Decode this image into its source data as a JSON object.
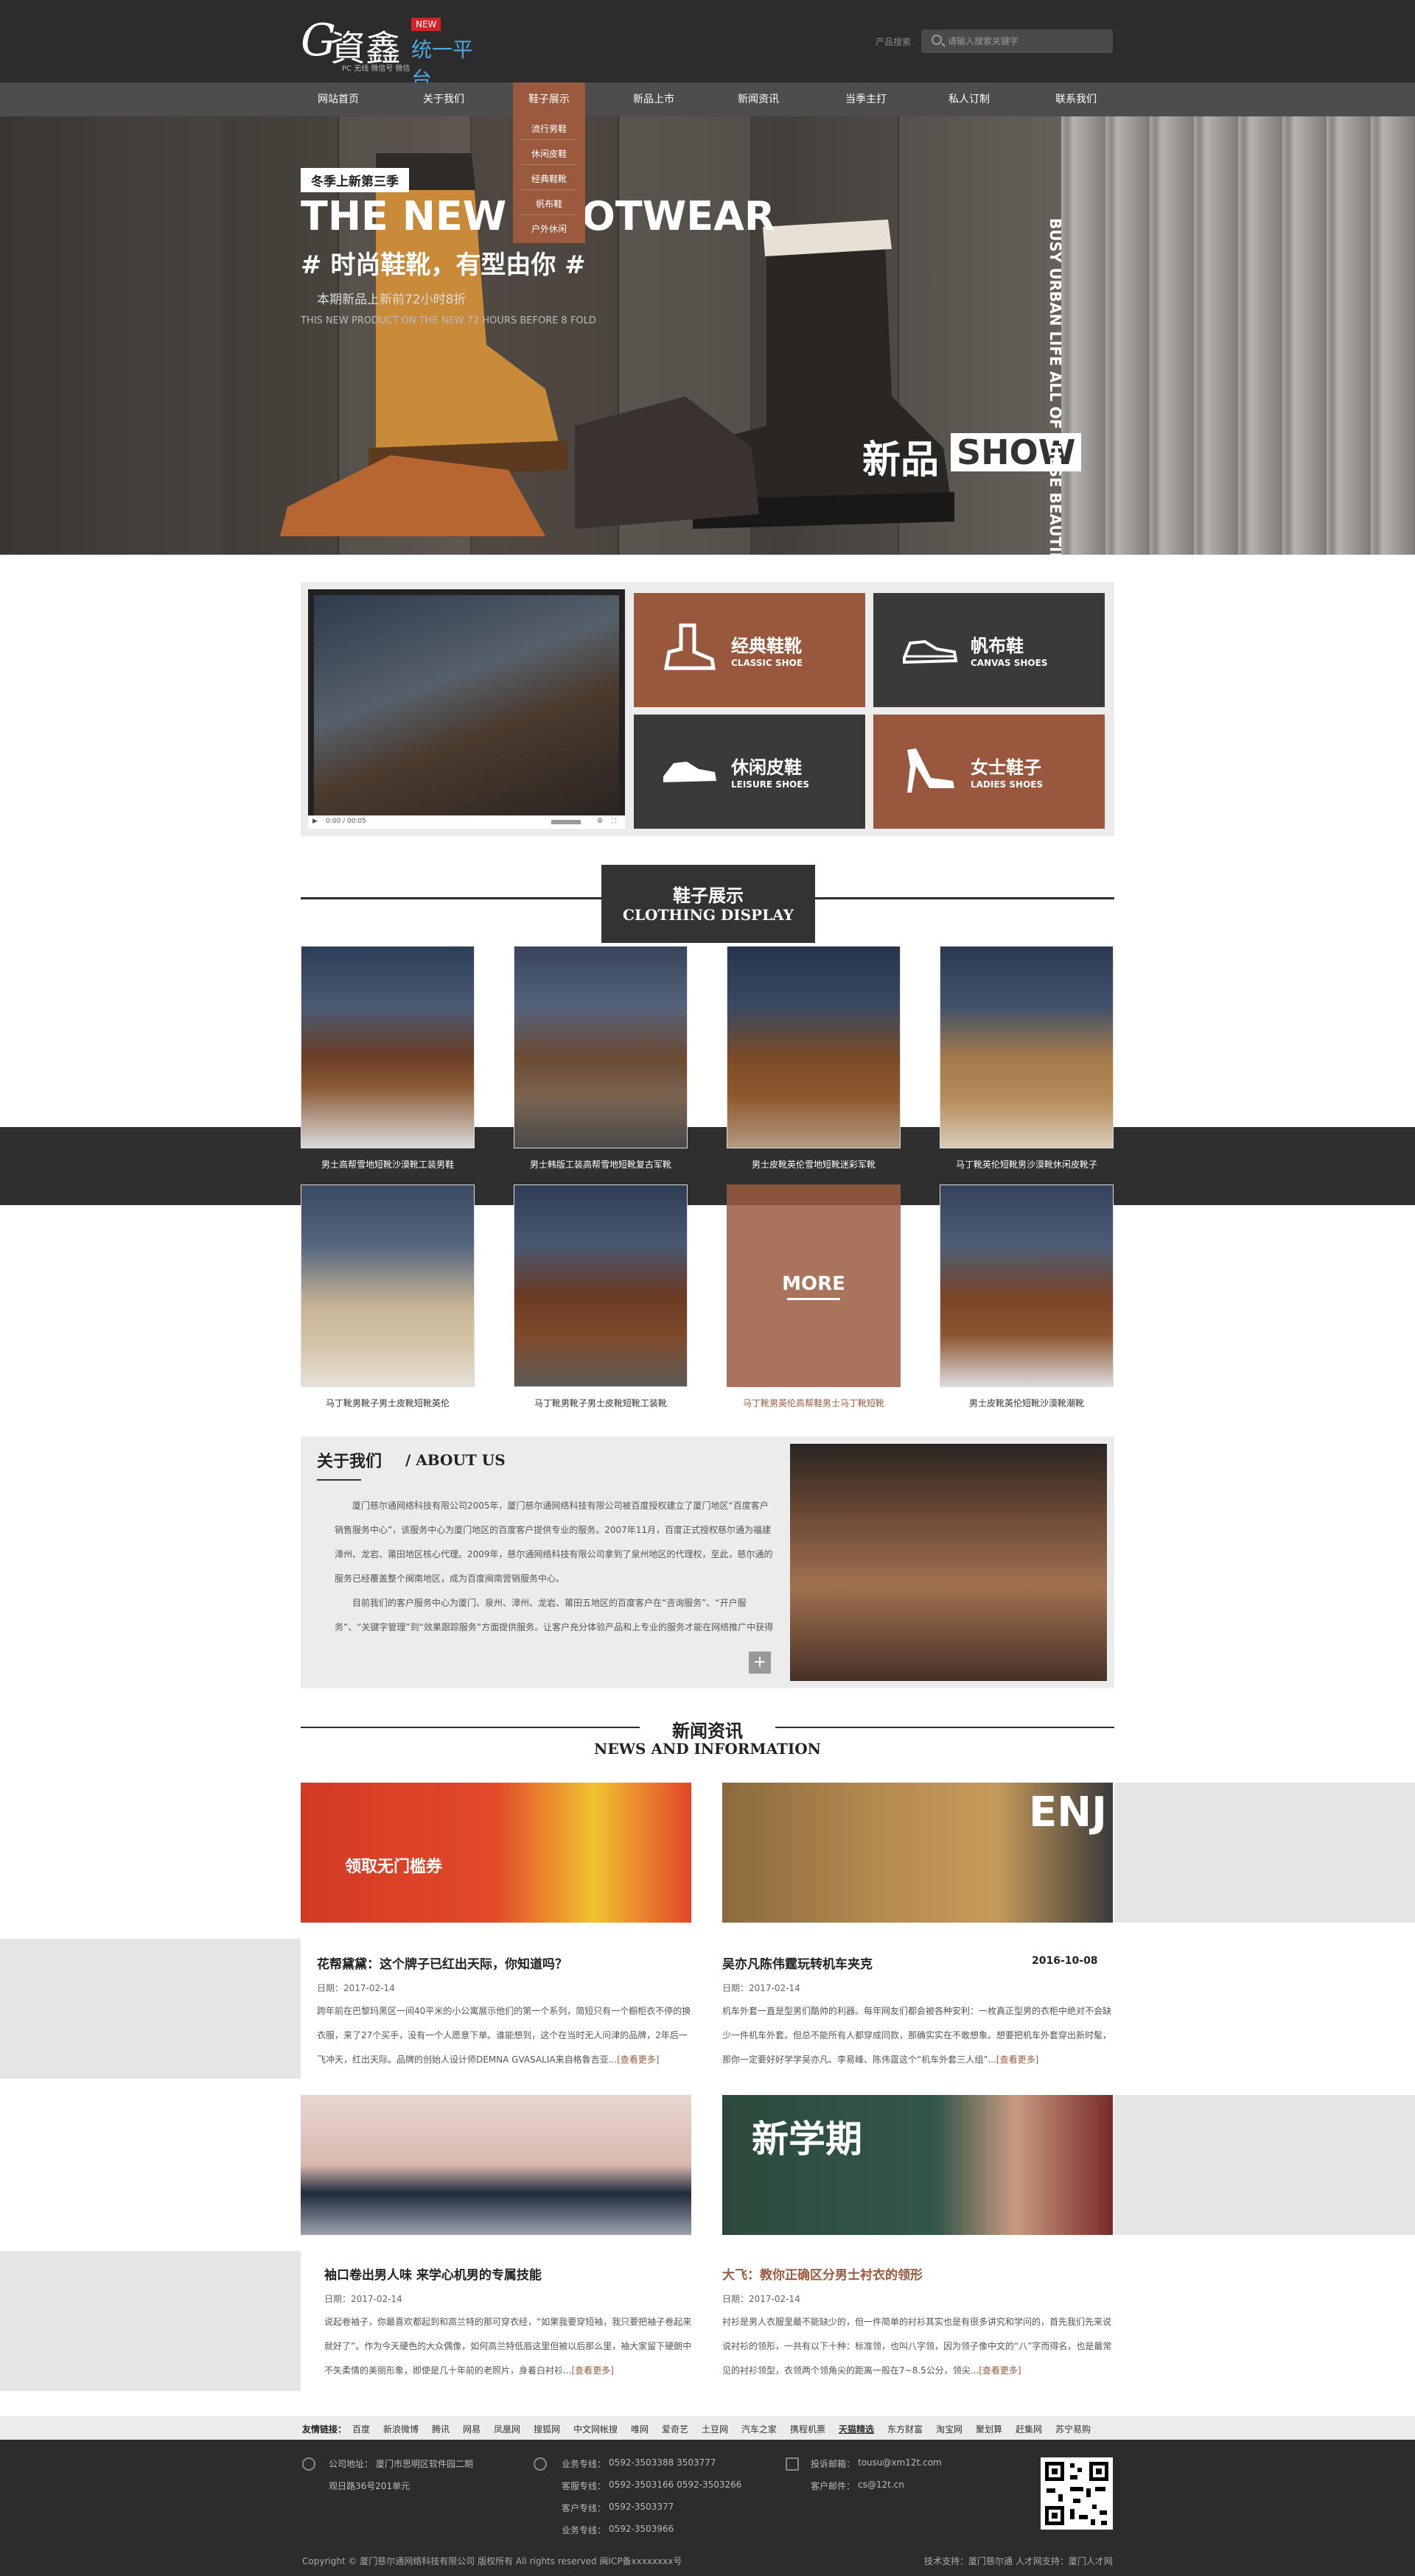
{
  "header": {
    "logo_mark": "資鑫",
    "logo_badge": "NEW",
    "logo_platform": "统一平台",
    "logo_sub": "PC 无线 微信号 微信",
    "search_label": "产品搜索",
    "search_placeholder": "请输入搜索关键字"
  },
  "nav": [
    "网站首页",
    "关于我们",
    "鞋子展示",
    "新品上市",
    "新闻资讯",
    "当季主打",
    "私人订制",
    "联系我们"
  ],
  "nav_dropdown": [
    "流行男鞋",
    "休闲皮鞋",
    "经典鞋靴",
    "帆布鞋",
    "户外休闲"
  ],
  "banner": {
    "tag": "冬季上新第三季",
    "title": "THE NEW FOOTWEAR",
    "subtitle": "# 时尚鞋靴，有型由你 #",
    "line1": "本期新品上新前72小时8折",
    "line2": "THIS NEW PRODUCT ON THE NEW 72 HOURS BEFORE 8 FOLD",
    "show_cn": "新品",
    "show_en": "SHOW",
    "vertical_text": "BUSY URBAN LIFE ALL OF THESE BEAUTIFUL WARDROBE HUNDRED FLATTERS"
  },
  "video_controls": {
    "time": "0:00 / 00:05"
  },
  "categories": [
    {
      "cn": "经典鞋靴",
      "en": "CLASSIC SHOE",
      "icon": "boot-icon"
    },
    {
      "cn": "帆布鞋",
      "en": "CANVAS SHOES",
      "icon": "sneaker-icon"
    },
    {
      "cn": "休闲皮鞋",
      "en": "LEISURE SHOES",
      "icon": "leather-shoe-icon"
    },
    {
      "cn": "女士鞋子",
      "en": "LADIES SHOES",
      "icon": "high-heel-icon"
    }
  ],
  "display": {
    "title_cn": "鞋子展示",
    "title_en": "CLOTHING DISPLAY",
    "products": [
      "男士高帮雪地短靴沙漠靴工装男鞋",
      "男士韩版工装高帮雪地短靴复古军靴",
      "男士皮靴英伦雪地短靴迷彩军靴",
      "马丁靴英伦短靴男沙漠靴休闲皮靴子",
      "马丁靴男靴子男士皮靴短靴英伦",
      "马丁靴男靴子男士皮靴短靴工装靴",
      "马丁靴男英伦高帮鞋男士马丁靴短靴",
      "男士皮靴英伦短靴沙漠靴潮靴"
    ],
    "more": "MORE"
  },
  "about": {
    "title_cn": "关于我们",
    "title_en": "/ ABOUT US",
    "p1": "厦门慈尔通网络科技有限公司2005年，厦门慈尔通网络科技有限公司被百度授权建立了厦门地区“百度客户销售服务中心”，该服务中心为厦门地区的百度客户提供专业的服务。2007年11月，百度正式授权慈尔通为福建漳州、龙岩、莆田地区核心代理。2009年，慈尔通网络科技有限公司拿到了泉州地区的代理权，至此，慈尔通的服务已经覆盖整个闽南地区，成为百度闽南营销服务中心。",
    "p2": "目前我们的客户服务中心为厦门、泉州、漳州、龙岩、莆田五地区的百度客户在“咨询服务”、“开户服务”、“关键字管理”到“效果跟踪服务”方面提供服务。让客户充分体验产品和上专业的服务才能在网络推广中获得",
    "plus": "+"
  },
  "news": {
    "title_cn": "新闻资讯",
    "title_en": "NEWS AND INFORMATION",
    "items": [
      {
        "title": "花帮黛黛：这个牌子已红出天际，你知道吗？",
        "date": "日期：2017-02-14",
        "body": "跨年前在巴黎玛黑区一间40平米的小公寓展示他们的第一个系列，简短只有一个橱柜衣不停的换衣服，来了27个买手，没有一个人愿意下单。谁能想到，这个在当时无人问津的品牌，2年后一飞冲天，红出天际。品牌的创始人设计师DEMNA GVASALIA来自格鲁吉亚...",
        "more": "[查看更多]",
        "img_caption": "领取无门槛券",
        "side_date": ""
      },
      {
        "title": "吴亦凡陈伟霆玩转机车夹克",
        "date": "日期：2017-02-14",
        "body": "机车外套一直是型男们酷帅的利器。每年网友们都会被各种安利：一枚真正型男的衣柜中绝对不会缺少一件机车外套。但总不能所有人都穿成同款，那确实实在不敢想象。想要把机车外套穿出新时髦，那你一定要好好学学吴亦凡、李易峰、陈伟霆这个“机车外套三人组”...",
        "more": "[查看更多]",
        "img_caption": "ENJ",
        "side_date": "2016-10-08"
      },
      {
        "title": "袖口卷出男人味 来学心机男的专属技能",
        "date": "日期：2017-02-14",
        "body": "说起卷袖子，你最喜欢都起到和高兰特的那可穿衣经，“如果我要穿短袖，我只要把袖子卷起来就好了”。作为今天硬色的大众偶像，如何高兰特低眉这里但被以后那么里，袖大家留下硬朗中不失柔情的美丽形象，即使是几十年前的老照片，身着白衬衫...",
        "more": "[查看更多]",
        "img_caption": "",
        "side_date": ""
      },
      {
        "title": "大飞：教你正确区分男士衬衣的领形",
        "date": "日期：2017-02-14",
        "body": "衬衫是男人衣服里最不能缺少的，但一件简单的衬衫其实也是有很多讲究和学问的，首先我们先来说说衬衫的领形，一共有以下十种：标准领，也叫八字领，因为领子像中文的“八”字而得名，也是最常见的衬衫领型，衣领两个领角尖的距离一般在7~8.5公分，领尖...",
        "more": "[查看更多]",
        "img_caption": "新学期",
        "side_date": ""
      }
    ]
  },
  "links": {
    "label": "友情链接：",
    "items": [
      "百度",
      "新浪微博",
      "腾讯",
      "网易",
      "凤凰网",
      "搜狐网",
      "中文网帐搜",
      "唯网",
      "爱奇艺",
      "土豆网",
      "汽车之家",
      "携程机票",
      "天猫精选",
      "东方财富",
      "淘宝网",
      "聚划算",
      "赶集网",
      "苏宁易购"
    ]
  },
  "footer": {
    "address_label": "公司地址：",
    "address1": "厦门市思明区软件园二期",
    "address2": "观日路36号201单元",
    "phone_label": "业务专线：",
    "phone1": "0592-3503388   3503777",
    "service_label": "客服专线：",
    "service": "0592-3503166   0592-3503266",
    "complaint_label": "客户专线：",
    "complaint": "0592-3503377",
    "biz_label": "业务专线：",
    "biz": "0592-3503966",
    "email_label": "投诉邮箱：",
    "email": "tousu@xm12t.com",
    "cust_email_label": "客户邮件：",
    "cust_email": "cs@12t.cn",
    "copyright": "Copyright © 厦门慈尔通网络科技有限公司 版权所有 All rights reserved  闽ICP备xxxxxxxx号",
    "tech": "技术支持：厦门慈尔通 人才网支持：厦门人才网"
  }
}
